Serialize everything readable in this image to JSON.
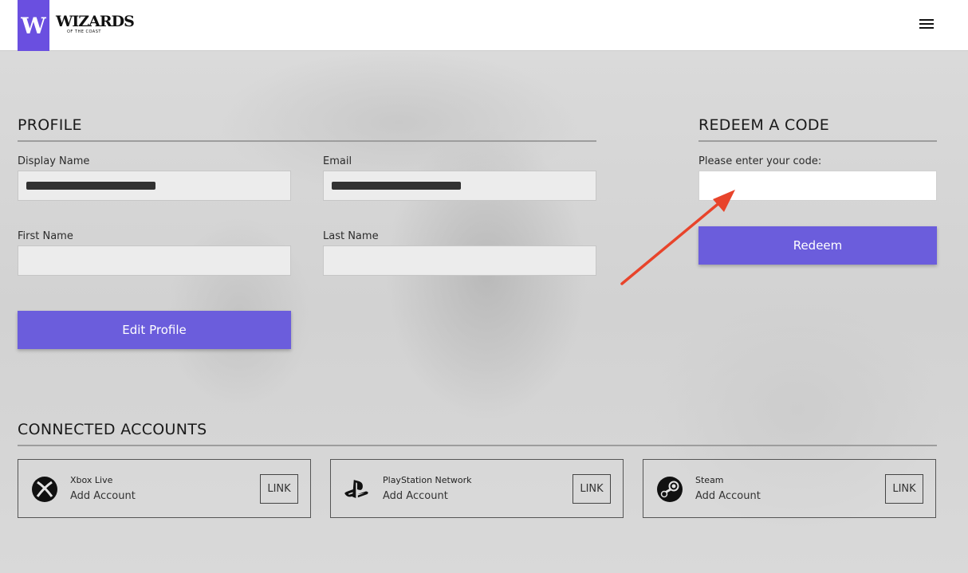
{
  "header": {
    "logo_letter": "W",
    "logo_word": "WIZARDS",
    "logo_tagline": "OF THE COAST",
    "menu_icon": "hamburger-icon"
  },
  "profile": {
    "title": "PROFILE",
    "display_name_label": "Display Name",
    "email_label": "Email",
    "first_name_label": "First Name",
    "last_name_label": "Last Name",
    "first_name_value": "",
    "last_name_value": "",
    "edit_button": "Edit Profile"
  },
  "redeem": {
    "title": "REDEEM A CODE",
    "prompt": "Please enter your code:",
    "code_value": "",
    "button": "Redeem"
  },
  "connected": {
    "title": "CONNECTED ACCOUNTS",
    "accounts": [
      {
        "name": "Xbox Live",
        "action": "Add Account",
        "link": "LINK",
        "icon": "xbox-icon"
      },
      {
        "name": "PlayStation Network",
        "action": "Add Account",
        "link": "LINK",
        "icon": "playstation-icon"
      },
      {
        "name": "Steam",
        "action": "Add Account",
        "link": "LINK",
        "icon": "steam-icon"
      }
    ]
  },
  "colors": {
    "brand": "#6a4fe0",
    "button": "#6b5ddc",
    "annotation_arrow": "#e8442b"
  }
}
